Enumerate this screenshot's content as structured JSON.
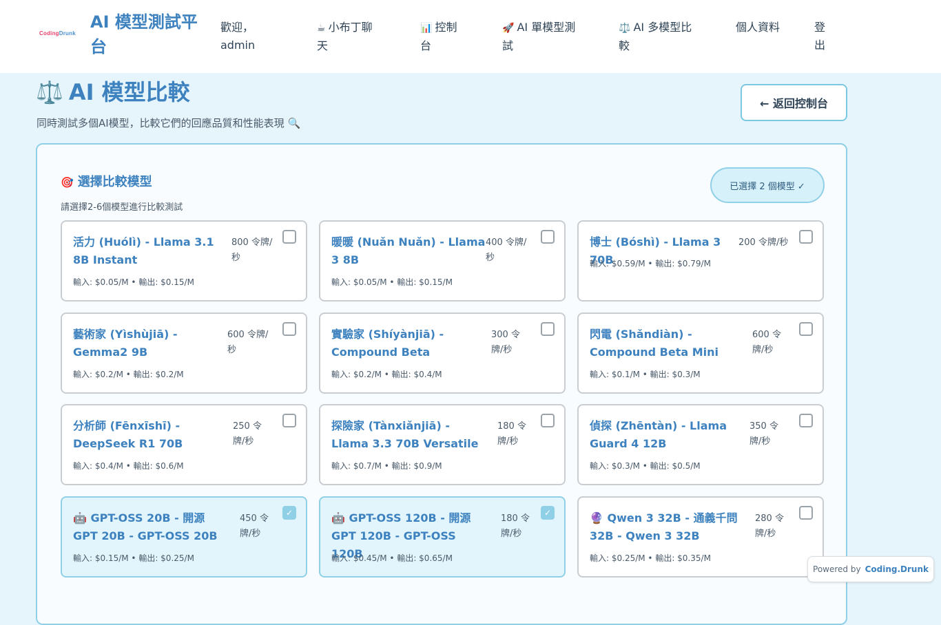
{
  "nav": {
    "logo_part1": "Coding",
    "logo_part2": "Drunk",
    "brand": "AI 模型測試平台",
    "items": [
      {
        "emoji": "",
        "label": "歡迎，admin"
      },
      {
        "emoji": "☕",
        "label": "小布丁聊天"
      },
      {
        "emoji": "📊",
        "label": "控制台"
      },
      {
        "emoji": "🚀",
        "label": "AI 單模型測試"
      },
      {
        "emoji": "⚖️",
        "label": "AI 多模型比較"
      },
      {
        "emoji": "",
        "label": "個人資料"
      },
      {
        "emoji": "",
        "label": "登出"
      }
    ]
  },
  "header": {
    "emoji": "⚖️",
    "title": "AI 模型比較",
    "subtitle": "同時測試多個AI模型，比較它們的回應品質和性能表現 🔍",
    "back_label": "← 返回控制台"
  },
  "select": {
    "emoji": "🎯",
    "title": "選擇比較模型",
    "description": "請選擇2-6個模型進行比較測試",
    "badge": "已選擇 2 個模型 ✓"
  },
  "models": [
    {
      "name": "活力 (Huólì) - Llama 3.1 8B Instant",
      "speed": "800 令牌/秒",
      "price": "輸入: $0.05/M • 輸出: $0.15/M",
      "checked": false
    },
    {
      "name": "暖暖 (Nuǎn Nuǎn) - Llama 3 8B",
      "speed": "400 令牌/秒",
      "price": "輸入: $0.05/M • 輸出: $0.15/M",
      "checked": false
    },
    {
      "name": "博士 (Bóshì) - Llama 3 70B",
      "speed": "200 令牌/秒",
      "price": "輸入: $0.59/M • 輸出: $0.79/M",
      "checked": false
    },
    {
      "name": "藝術家 (Yìshùjiā) - Gemma2 9B",
      "speed": "600 令牌/秒",
      "price": "輸入: $0.2/M • 輸出: $0.2/M",
      "checked": false
    },
    {
      "name": "實驗家 (Shíyànjiā) - Compound Beta",
      "speed": "300 令牌/秒",
      "price": "輸入: $0.2/M • 輸出: $0.4/M",
      "checked": false
    },
    {
      "name": "閃電 (Shǎndiàn) - Compound Beta Mini",
      "speed": "600 令牌/秒",
      "price": "輸入: $0.1/M • 輸出: $0.3/M",
      "checked": false
    },
    {
      "name": "分析師 (Fēnxīshī) - DeepSeek R1 70B",
      "speed": "250 令牌/秒",
      "price": "輸入: $0.4/M • 輸出: $0.6/M",
      "checked": false
    },
    {
      "name": "探險家 (Tànxiǎnjiā) - Llama 3.3 70B Versatile",
      "speed": "180 令牌/秒",
      "price": "輸入: $0.7/M • 輸出: $0.9/M",
      "checked": false
    },
    {
      "name": "偵探 (Zhēntàn) - Llama Guard 4 12B",
      "speed": "350 令牌/秒",
      "price": "輸入: $0.3/M • 輸出: $0.5/M",
      "checked": false
    },
    {
      "name": "🤖 GPT-OSS 20B - 開源 GPT 20B - GPT-OSS 20B",
      "speed": "450 令牌/秒",
      "price": "輸入: $0.15/M • 輸出: $0.25/M",
      "checked": true
    },
    {
      "name": "🤖 GPT-OSS 120B - 開源 GPT 120B - GPT-OSS 120B",
      "speed": "180 令牌/秒",
      "price": "輸入: $0.45/M • 輸出: $0.65/M",
      "checked": true
    },
    {
      "name": "🔮 Qwen 3 32B - 通義千問 32B - Qwen 3 32B",
      "speed": "280 令牌/秒",
      "price": "輸入: $0.25/M • 輸出: $0.35/M",
      "checked": false
    }
  ],
  "footer": {
    "powered_label": "Powered by",
    "powered_brand": "Coding.Drunk"
  },
  "colors": {
    "accent": "#3d82bf",
    "selected_bg": "#e3f5fc",
    "border_accent": "#8fd0e6",
    "page_bg": "#e6f5fc"
  }
}
